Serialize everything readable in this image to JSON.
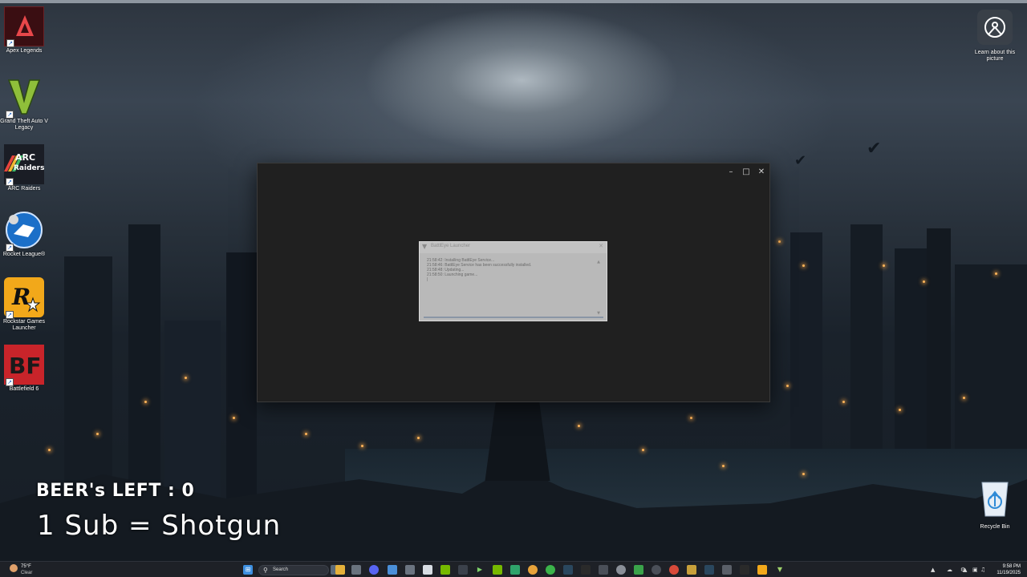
{
  "desktop": {
    "icons": [
      {
        "label": "Apex Legends",
        "icon": "apex-legends-icon"
      },
      {
        "label": "Grand Theft Auto V Legacy",
        "icon": "gta-v-icon"
      },
      {
        "label": "ARC Raiders",
        "icon": "arc-raiders-icon"
      },
      {
        "label": "Rocket League®",
        "icon": "rocket-league-icon"
      },
      {
        "label": "Rockstar Games Launcher",
        "icon": "rockstar-icon"
      },
      {
        "label": "Battlefield 6",
        "icon": "battlefield-6-icon"
      }
    ],
    "learn_label": "Learn about this picture",
    "recycle_label": "Recycle Bin"
  },
  "overlay": {
    "beer_text": "BEER's LEFT : 0",
    "sub_text": "1 Sub = Shotgun"
  },
  "dialog": {
    "title": "BattlEye Launcher",
    "log": [
      "21:58:42: Installing BattlEye Service...",
      "21:58:46: BattlEye Service has been successfully installed.",
      "21:58:48: Updating...",
      "21:58:50: Launching game...",
      "|"
    ]
  },
  "taskbar": {
    "weather_temp": "75°F",
    "weather_cond": "Clear",
    "search_placeholder": "Search",
    "time": "9:58 PM",
    "date": "11/19/2025"
  },
  "colors": {
    "window_bg": "#202020",
    "taskbar_bg": "#1e2127",
    "dialog_bg": "#b9b9b9"
  }
}
